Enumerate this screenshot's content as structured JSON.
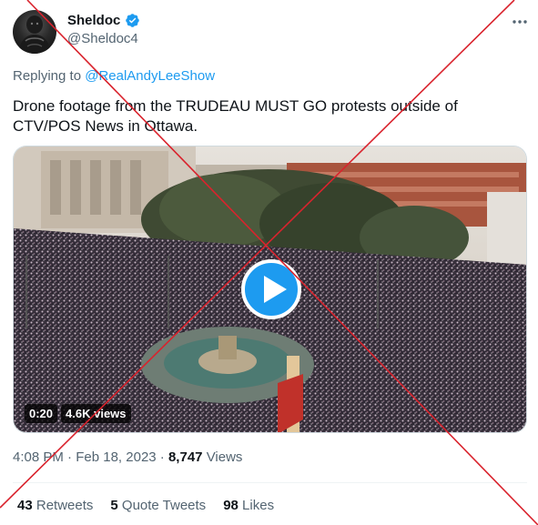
{
  "author": {
    "display_name": "Sheldoc",
    "handle": "@Sheldoc4",
    "verified_icon": "verified-badge-icon"
  },
  "reply": {
    "prefix": "Replying to ",
    "mention": "@RealAndyLeeShow"
  },
  "tweet": {
    "text": "Drone footage from the TRUDEAU MUST GO protests outside of CTV/POS News in Ottawa."
  },
  "video": {
    "duration": "0:20",
    "views_badge": "4.6K views",
    "play_icon": "play-icon"
  },
  "meta": {
    "time": "4:08 PM",
    "separator": "·",
    "date": "Feb 18, 2023",
    "views_count": "8,747",
    "views_label": "Views"
  },
  "stats": [
    {
      "count": "43",
      "label": "Retweets"
    },
    {
      "count": "5",
      "label": "Quote Tweets"
    },
    {
      "count": "98",
      "label": "Likes"
    }
  ],
  "colors": {
    "accent": "#1d9bf0",
    "secondary_text": "#536471",
    "overlay_cross": "#d9232d"
  }
}
